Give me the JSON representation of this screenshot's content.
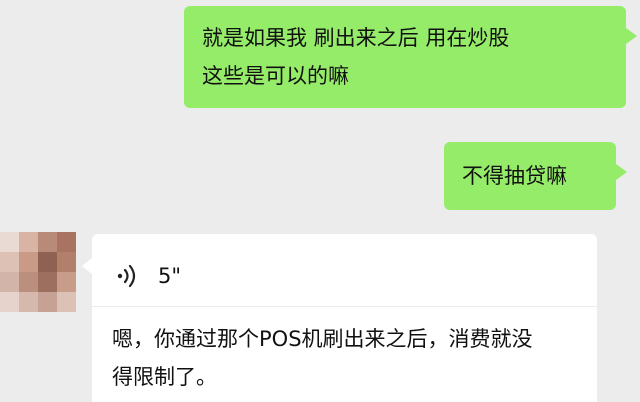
{
  "messages": [
    {
      "side": "right",
      "type": "text",
      "lines": [
        "就是如果我 刷出来之后 用在炒股",
        "这些是可以的嘛"
      ],
      "bubble_color": "#95ec69"
    },
    {
      "side": "right",
      "type": "text",
      "lines": [
        "不得抽贷嘛"
      ],
      "bubble_color": "#95ec69"
    },
    {
      "side": "left",
      "type": "voice",
      "voice_icon": "voice-wave-icon",
      "duration": "5\"",
      "transcript_lines": [
        "嗯，你通过那个POS机刷出来之后，消费就没",
        "得限制了。"
      ],
      "bubble_color": "#ffffff"
    }
  ],
  "avatar_icon": "blurred-avatar",
  "background_color": "#ececec"
}
